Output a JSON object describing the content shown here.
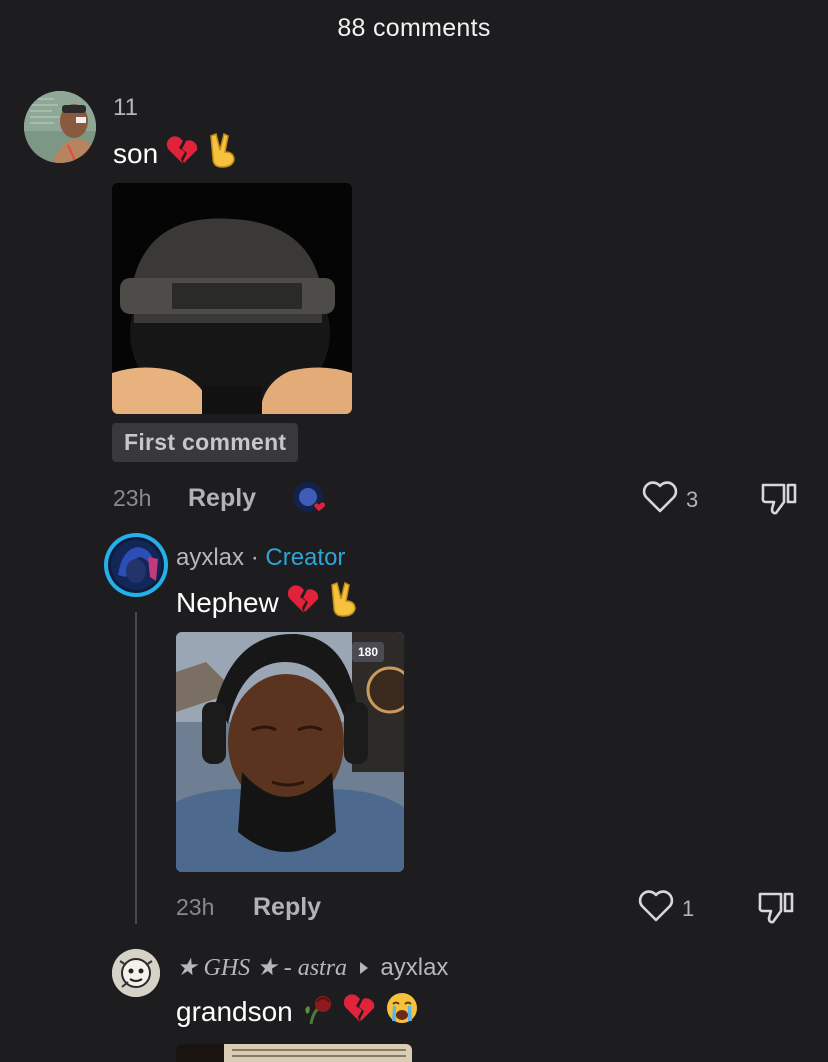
{
  "header": {
    "title": "88 comments"
  },
  "comments": [
    {
      "username": "11",
      "text": "son",
      "badge": "First comment",
      "time": "23h",
      "reply_label": "Reply",
      "likes": "3"
    },
    {
      "username": "ayxlax",
      "separator": "·",
      "creator_label": "Creator",
      "text": "Nephew",
      "video_overlay": "180",
      "time": "23h",
      "reply_label": "Reply",
      "likes": "1"
    },
    {
      "username": "★ GHS ★ - astra",
      "reply_to": "ayxlax",
      "text": "grandson"
    }
  ],
  "colors": {
    "background": "#1d1d1f",
    "creator": "#2ea3d6",
    "heart": "#e0223a",
    "ring": "#24b0e8"
  },
  "icons": [
    "broken-heart-icon",
    "victory-hand-icon",
    "heart-outline-icon",
    "thumbs-down-icon",
    "wilted-rose-icon",
    "crying-face-icon",
    "caret-right-icon"
  ]
}
